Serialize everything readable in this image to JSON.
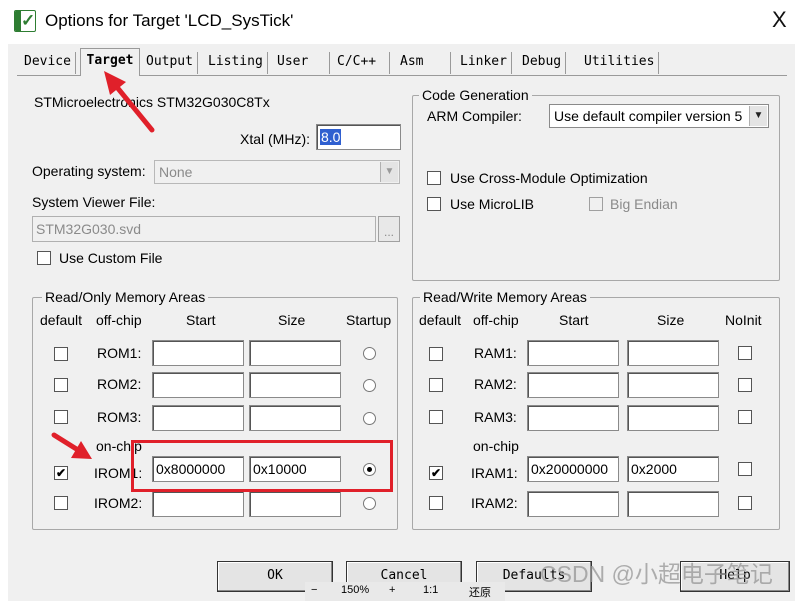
{
  "window": {
    "title": "Options for Target 'LCD_SysTick'",
    "close_glyph": "X"
  },
  "tabs": [
    {
      "label": "Device"
    },
    {
      "label": "Target"
    },
    {
      "label": "Output"
    },
    {
      "label": "Listing"
    },
    {
      "label": "User"
    },
    {
      "label": "C/C++"
    },
    {
      "label": "Asm"
    },
    {
      "label": "Linker"
    },
    {
      "label": "Debug"
    },
    {
      "label": "Utilities"
    }
  ],
  "target": {
    "device_name": "STMicroelectronics STM32G030C8Tx",
    "xtal_label": "Xtal (MHz):",
    "xtal_value": "8.0",
    "os_label": "Operating system:",
    "os_value": "None",
    "svd_label": "System Viewer File:",
    "svd_value": "STM32G030.svd",
    "browse_label": "...",
    "use_custom_file": "Use Custom File"
  },
  "code_generation": {
    "legend": "Code Generation",
    "compiler_label": "ARM Compiler:",
    "compiler_value": "Use default compiler version 5",
    "cross_module": "Use Cross-Module Optimization",
    "microlib": "Use MicroLIB",
    "big_endian": "Big Endian"
  },
  "rom_area": {
    "legend": "Read/Only Memory Areas",
    "headers": {
      "default": "default",
      "offchip": "off-chip",
      "start": "Start",
      "size": "Size",
      "startup": "Startup"
    },
    "onchip_label": "on-chip",
    "rows": [
      {
        "label": "ROM1:",
        "start": "",
        "size": "",
        "default": false,
        "startup": false
      },
      {
        "label": "ROM2:",
        "start": "",
        "size": "",
        "default": false,
        "startup": false
      },
      {
        "label": "ROM3:",
        "start": "",
        "size": "",
        "default": false,
        "startup": false
      },
      {
        "label": "IROM1:",
        "start": "0x8000000",
        "size": "0x10000",
        "default": true,
        "startup": true
      },
      {
        "label": "IROM2:",
        "start": "",
        "size": "",
        "default": false,
        "startup": false
      }
    ]
  },
  "ram_area": {
    "legend": "Read/Write Memory Areas",
    "headers": {
      "default": "default",
      "offchip": "off-chip",
      "start": "Start",
      "size": "Size",
      "noinit": "NoInit"
    },
    "onchip_label": "on-chip",
    "rows": [
      {
        "label": "RAM1:",
        "start": "",
        "size": "",
        "default": false,
        "noinit": false
      },
      {
        "label": "RAM2:",
        "start": "",
        "size": "",
        "default": false,
        "noinit": false
      },
      {
        "label": "RAM3:",
        "start": "",
        "size": "",
        "default": false,
        "noinit": false
      },
      {
        "label": "IRAM1:",
        "start": "0x20000000",
        "size": "0x2000",
        "default": true,
        "noinit": false
      },
      {
        "label": "IRAM2:",
        "start": "",
        "size": "",
        "default": false,
        "noinit": false
      }
    ]
  },
  "buttons": {
    "ok": "OK",
    "cancel": "Cancel",
    "defaults": "Defaults",
    "help": "Help"
  },
  "viewer_bar": {
    "minus": "−",
    "zoom": "150%",
    "plus": "+",
    "ratio": "1:1",
    "restore": "还原"
  },
  "watermark": "CSDN @小超电子笔记",
  "colors": {
    "highlight_box": "#e0202a",
    "annotation_arrow": "#e0202a",
    "selection": "#2f5fd0"
  }
}
